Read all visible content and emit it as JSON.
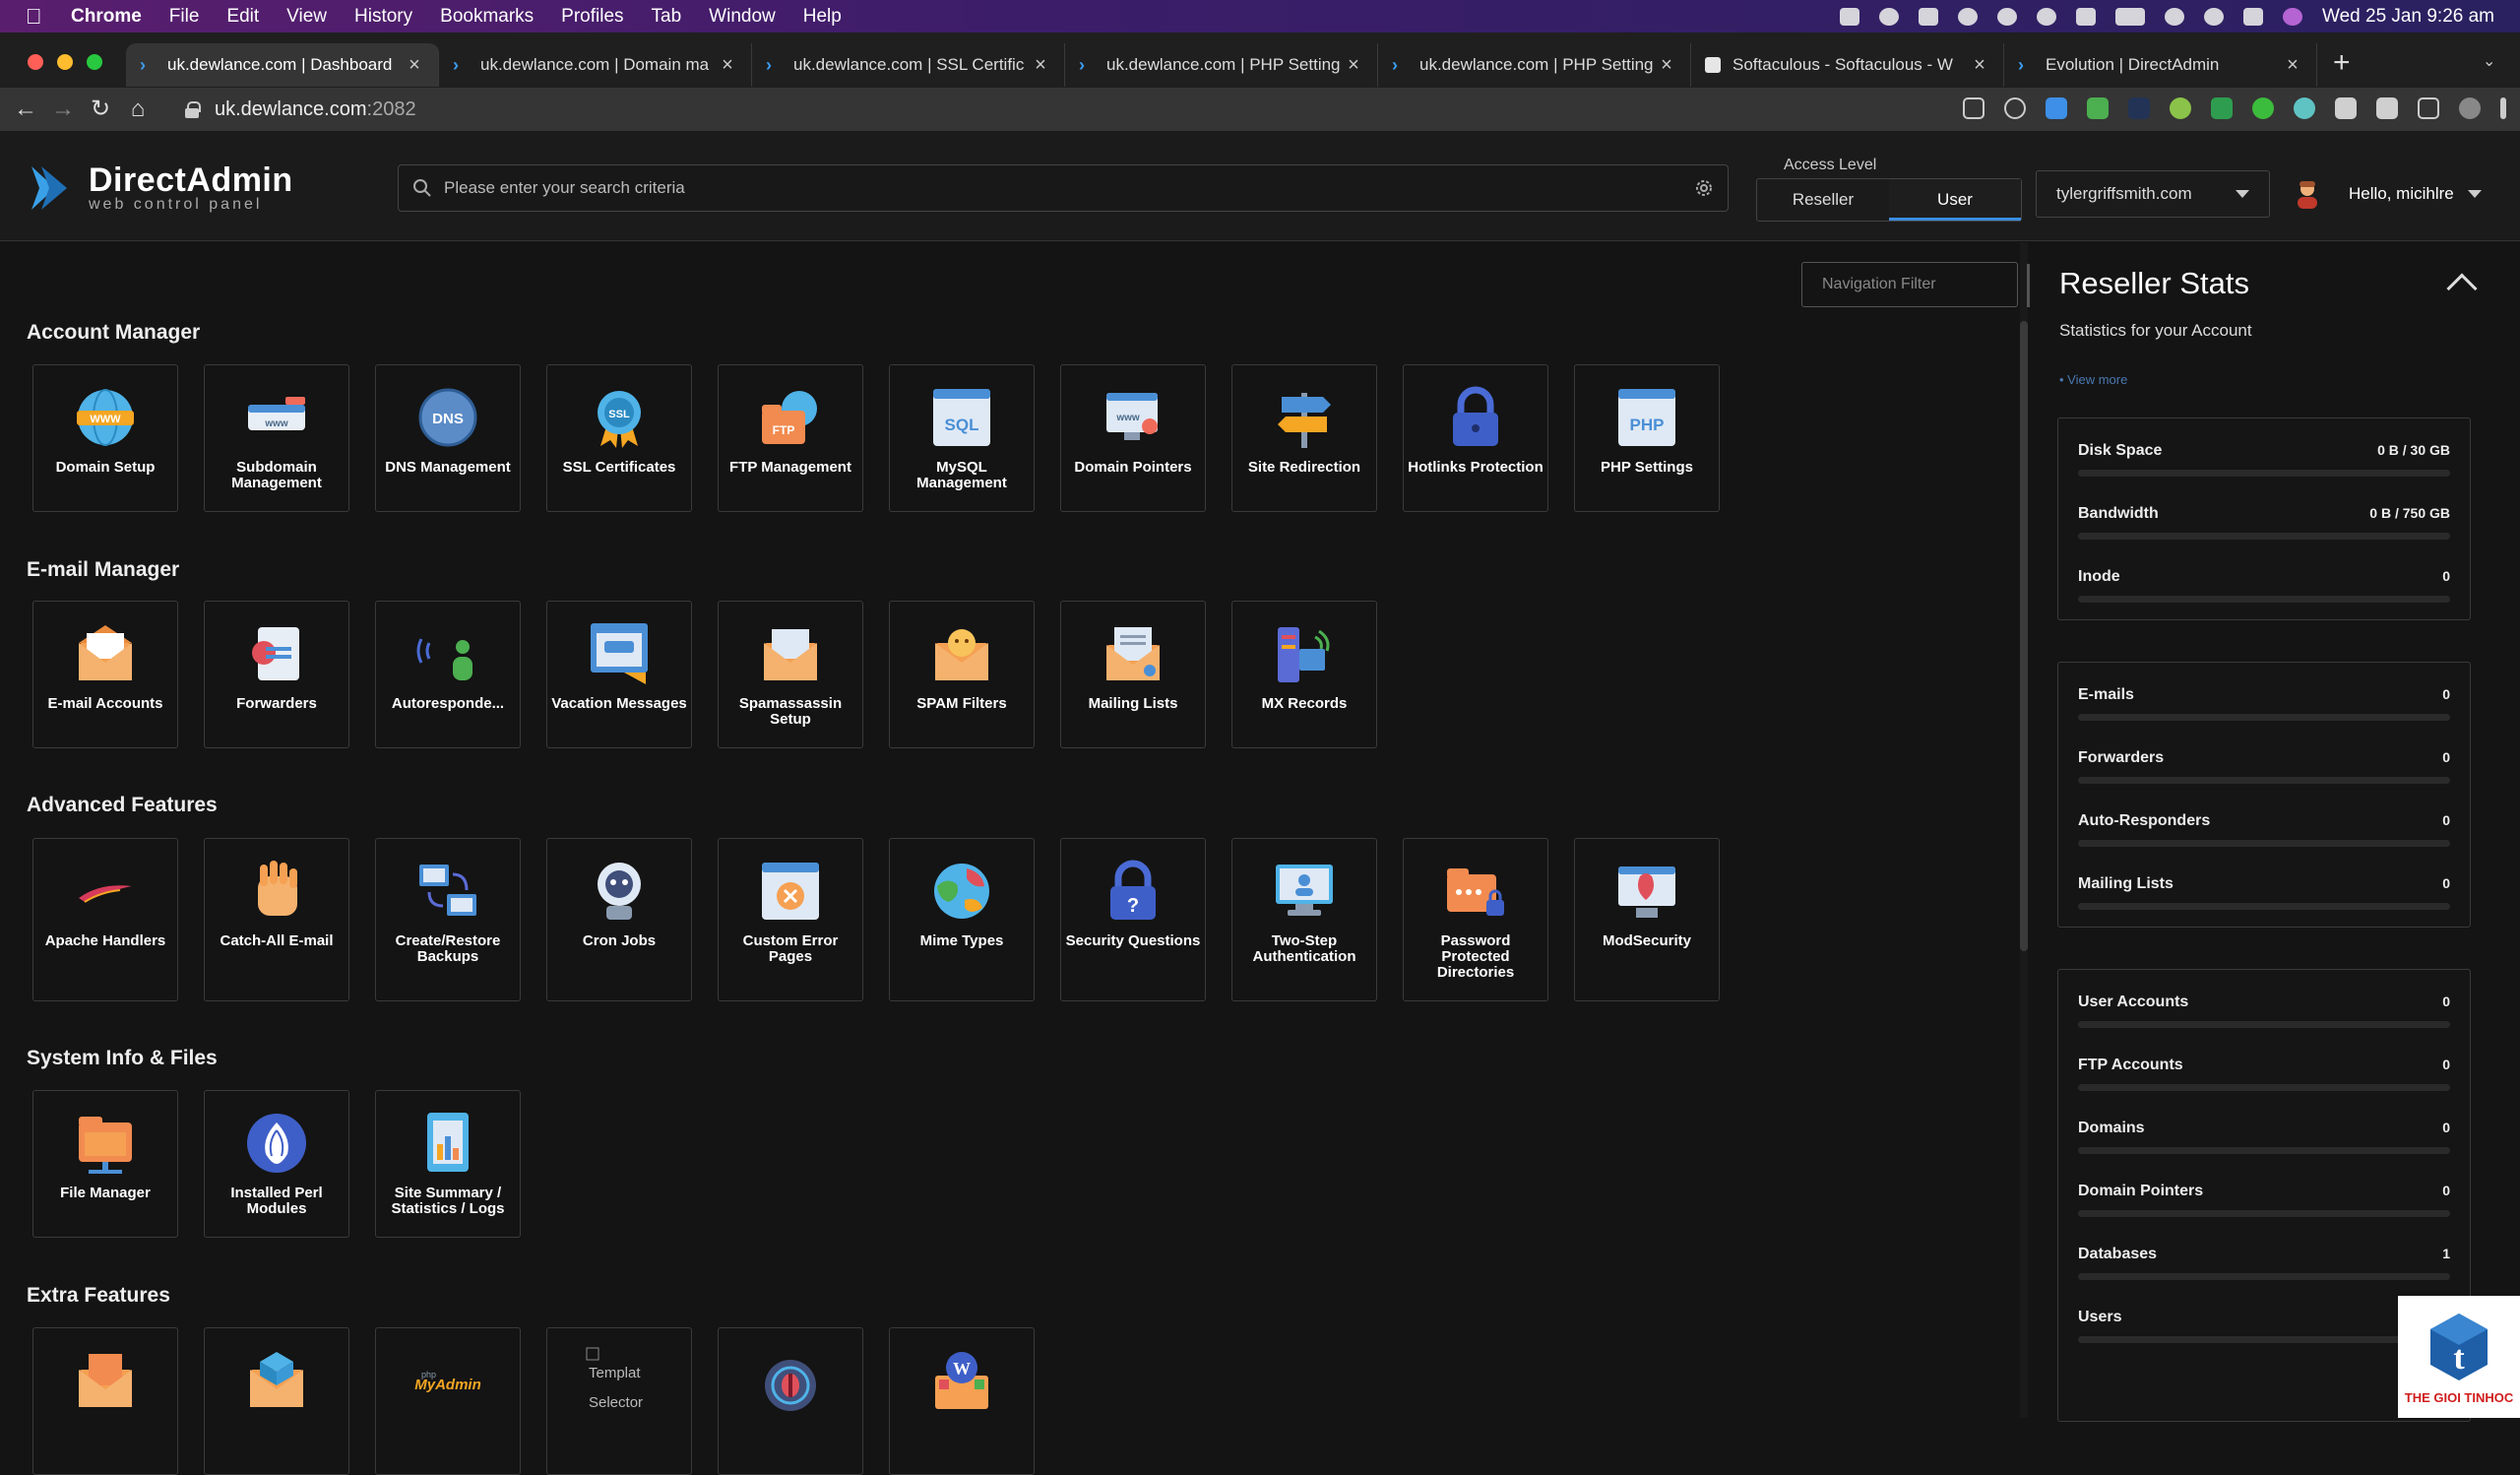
{
  "menubar": {
    "app": "Chrome",
    "items": [
      "File",
      "Edit",
      "View",
      "History",
      "Bookmarks",
      "Profiles",
      "Tab",
      "Window",
      "Help"
    ],
    "clock": "Wed 25 Jan 9:26 am"
  },
  "tabs": [
    {
      "title": "uk.dewlance.com | Dashboard",
      "active": true
    },
    {
      "title": "uk.dewlance.com | Domain ma",
      "active": false
    },
    {
      "title": "uk.dewlance.com | SSL Certific",
      "active": false
    },
    {
      "title": "uk.dewlance.com | PHP Setting",
      "active": false
    },
    {
      "title": "uk.dewlance.com | PHP Setting",
      "active": false
    },
    {
      "title": "Softaculous - Softaculous - W",
      "active": false
    },
    {
      "title": "Evolution | DirectAdmin",
      "active": false
    }
  ],
  "address": {
    "host": "uk.dewlance.com",
    "port": ":2082"
  },
  "header": {
    "logo_title": "DirectAdmin",
    "logo_sub": "web control panel",
    "search_placeholder": "Please enter your search criteria",
    "access_label": "Access Level",
    "access_options": [
      "Reseller",
      "User"
    ],
    "access_selected": "User",
    "domain": "tylergriffsmith.com",
    "greeting": "Hello, micihlre"
  },
  "nav_filter_placeholder": "Navigation Filter",
  "sections": [
    {
      "title": "Account Manager",
      "items": [
        {
          "label": "Domain Setup",
          "icon": "globe-www-icon"
        },
        {
          "label": "Subdomain Management",
          "icon": "subdomain-icon"
        },
        {
          "label": "DNS Management",
          "icon": "dns-icon"
        },
        {
          "label": "SSL Certificates",
          "icon": "ssl-badge-icon"
        },
        {
          "label": "FTP Management",
          "icon": "ftp-folder-icon"
        },
        {
          "label": "MySQL Management",
          "icon": "sql-database-icon"
        },
        {
          "label": "Domain Pointers",
          "icon": "domain-pointer-icon"
        },
        {
          "label": "Site Redirection",
          "icon": "signpost-icon"
        },
        {
          "label": "Hotlinks Protection",
          "icon": "padlock-icon"
        },
        {
          "label": "PHP Settings",
          "icon": "php-window-icon"
        }
      ]
    },
    {
      "title": "E-mail Manager",
      "items": [
        {
          "label": "E-mail Accounts",
          "icon": "envelope-icon"
        },
        {
          "label": "Forwarders",
          "icon": "forward-mail-icon"
        },
        {
          "label": "Autoresponde...",
          "icon": "autoresponder-icon"
        },
        {
          "label": "Vacation Messages",
          "icon": "vacation-message-icon"
        },
        {
          "label": "Spamassassin Setup",
          "icon": "spam-envelope-icon"
        },
        {
          "label": "SPAM Filters",
          "icon": "spam-filter-icon"
        },
        {
          "label": "Mailing Lists",
          "icon": "mailing-list-icon"
        },
        {
          "label": "MX Records",
          "icon": "mx-server-icon"
        }
      ]
    },
    {
      "title": "Advanced Features",
      "items": [
        {
          "label": "Apache Handlers",
          "icon": "apache-feather-icon"
        },
        {
          "label": "Catch-All E-mail",
          "icon": "catch-hand-icon"
        },
        {
          "label": "Create/Restore Backups",
          "icon": "backup-computers-icon"
        },
        {
          "label": "Cron Jobs",
          "icon": "cron-robot-icon"
        },
        {
          "label": "Custom Error Pages",
          "icon": "error-page-icon"
        },
        {
          "label": "Mime Types",
          "icon": "mime-globe-icon"
        },
        {
          "label": "Security Questions",
          "icon": "question-lock-icon"
        },
        {
          "label": "Two-Step Authentication",
          "icon": "two-step-auth-icon"
        },
        {
          "label": "Password Protected Directories",
          "icon": "protected-folder-icon"
        },
        {
          "label": "ModSecurity",
          "icon": "modsecurity-icon"
        }
      ]
    },
    {
      "title": "System Info & Files",
      "items": [
        {
          "label": "File Manager",
          "icon": "file-manager-icon"
        },
        {
          "label": "Installed Perl Modules",
          "icon": "perl-onion-icon"
        },
        {
          "label": "Site Summary / Statistics / Logs",
          "icon": "statistics-icon"
        }
      ]
    },
    {
      "title": "Extra Features",
      "items": [
        {
          "label": "",
          "icon": "extra-mail-icon"
        },
        {
          "label": "",
          "icon": "extra-box-icon"
        },
        {
          "label": "",
          "icon": "phpmyadmin-icon",
          "logo_text": "phpMyAdmin"
        },
        {
          "label": "",
          "icon": "template-selector-icon",
          "alt_text": "Template Selector"
        },
        {
          "label": "",
          "icon": "bug-icon"
        },
        {
          "label": "",
          "icon": "wordpress-icon"
        }
      ]
    }
  ],
  "stats": {
    "title": "Reseller Stats",
    "subtitle": "Statistics for your Account",
    "view_more": "• View more",
    "groups": [
      [
        {
          "k": "Disk Space",
          "v": "0 B / 30 GB"
        },
        {
          "k": "Bandwidth",
          "v": "0 B / 750 GB"
        },
        {
          "k": "Inode",
          "v": "0"
        }
      ],
      [
        {
          "k": "E-mails",
          "v": "0"
        },
        {
          "k": "Forwarders",
          "v": "0"
        },
        {
          "k": "Auto-Responders",
          "v": "0"
        },
        {
          "k": "Mailing Lists",
          "v": "0"
        }
      ],
      [
        {
          "k": "User Accounts",
          "v": "0"
        },
        {
          "k": "FTP Accounts",
          "v": "0"
        },
        {
          "k": "Domains",
          "v": "0"
        },
        {
          "k": "Domain Pointers",
          "v": "0"
        },
        {
          "k": "Databases",
          "v": "1"
        },
        {
          "k": "Users",
          "v": ""
        }
      ]
    ]
  },
  "watermark": "THE GIOI TINHOC",
  "colors": {
    "accent": "#3b8ee0",
    "menubar": "#3c1d6a"
  }
}
